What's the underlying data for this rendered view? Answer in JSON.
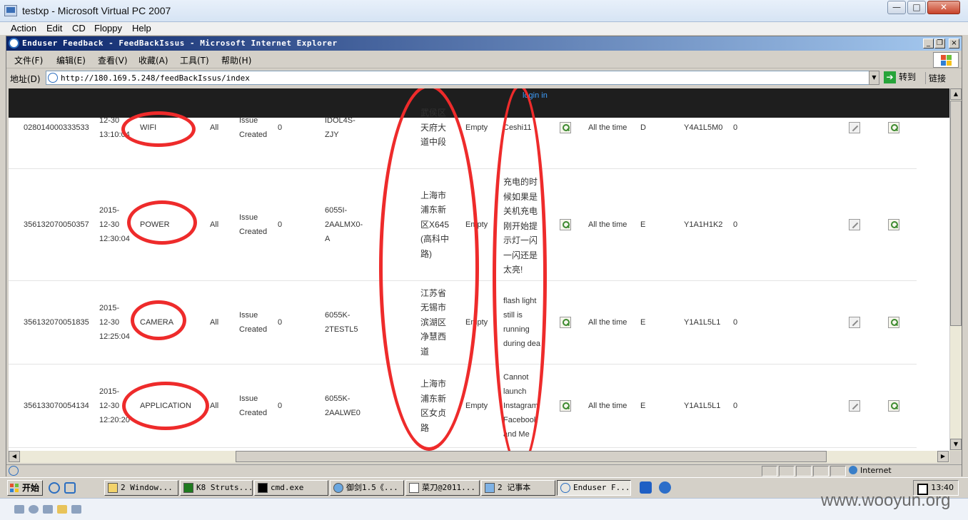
{
  "vpc": {
    "title": "testxp - Microsoft Virtual PC 2007",
    "menu": [
      "Action",
      "Edit",
      "CD",
      "Floppy",
      "Help"
    ],
    "controls": [
      "—",
      "□",
      "✕"
    ]
  },
  "ie": {
    "title": "Enduser Feedback - FeedBackIssus - Microsoft Internet Explorer",
    "menu": [
      "文件(F)",
      "编辑(E)",
      "查看(V)",
      "收藏(A)",
      "工具(T)",
      "帮助(H)"
    ],
    "address_label": "地址(D)",
    "url": "http://180.169.5.248/feedBackIssus/index",
    "go_label": "转到",
    "links_label": "链接",
    "status_zone": "Internet"
  },
  "page": {
    "login_link": "login in",
    "rows": [
      {
        "imei": "028014000333533",
        "date": "12-30\n13:10:04",
        "category": "WIFI",
        "scope": "All",
        "status": "Issue\nCreated",
        "count": "0",
        "model": "IDOL4S-\nZJY",
        "address": "武侯区\n天府大\n道中段",
        "email": "Empty",
        "description": "Ceshi11",
        "frequency": "All the time",
        "grade": "D",
        "version": "Y4A1L5M0",
        "flag": "0"
      },
      {
        "imei": "356132070050357",
        "date": "2015-\n12-30\n12:30:04",
        "category": "POWER",
        "scope": "All",
        "status": "Issue\nCreated",
        "count": "0",
        "model": "6055I-\n2AALMX0-\nA",
        "address": "上海市\n浦东新\n区X645\n(高科中\n路)",
        "email": "Empty",
        "description": "充电的时\n候如果是\n关机充电\n刚开始提\n示灯一闪\n一闪还是\n太亮!",
        "frequency": "All the time",
        "grade": "E",
        "version": "Y1A1H1K2",
        "flag": "0"
      },
      {
        "imei": "356132070051835",
        "date": "2015-\n12-30\n12:25:04",
        "category": "CAMERA",
        "scope": "All",
        "status": "Issue\nCreated",
        "count": "0",
        "model": "6055K-\n2TESTL5",
        "address": "江苏省\n无锡市\n滨湖区\n净慧西\n道",
        "email": "Empty",
        "description": "flash light\nstill is\nrunning\nduring deal",
        "frequency": "All the time",
        "grade": "E",
        "version": "Y1A1L5L1",
        "flag": "0"
      },
      {
        "imei": "356133070054134",
        "date": "2015-\n12-30\n12:20:20",
        "category": "APPLICATION",
        "scope": "All",
        "status": "Issue\nCreated",
        "count": "0",
        "model": "6055K-\n2AALWE0",
        "address": "上海市\n浦东新\n区女贞\n路",
        "email": "Empty",
        "description": "Cannot\nlaunch\nInstagram\nFacebook\nand Me",
        "frequency": "All the time",
        "grade": "E",
        "version": "Y1A1L5L1",
        "flag": "0"
      }
    ]
  },
  "taskbar": {
    "start_label": "开始",
    "tasks": [
      "2 Window...",
      "K8 Struts...",
      "cmd.exe",
      "御剑1.5《...",
      "菜刀@2011...",
      "2 记事本",
      "Enduser F..."
    ],
    "clock": "13:40"
  },
  "watermark": "www.wooyun.org",
  "colors": {
    "annotation_red": "#ee2b2b",
    "header_black": "#1e1e1e",
    "link_blue": "#3fa0ff"
  }
}
